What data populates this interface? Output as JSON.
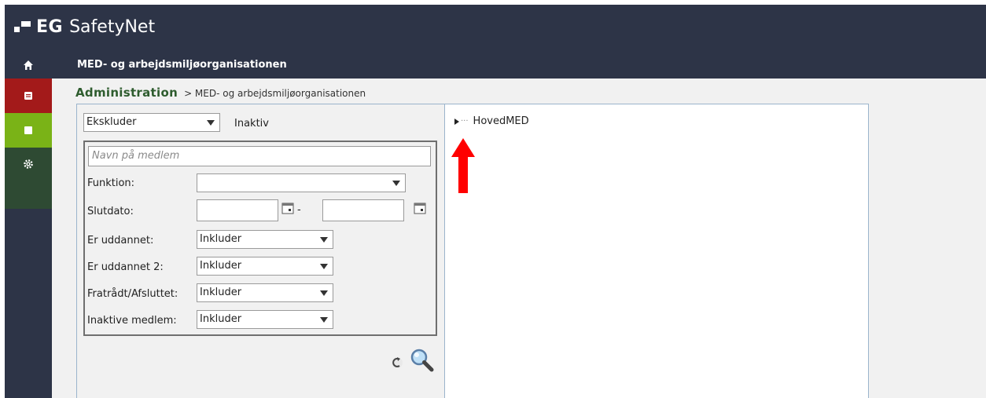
{
  "header": {
    "brand_mark": "EG",
    "app_name": "SafetyNet",
    "page_title": "MED- og arbejdsmiljøorganisationen"
  },
  "sidebar": {
    "items": [
      {
        "icon": "home-icon"
      },
      {
        "icon": "document-icon",
        "color": "#a31a1a"
      },
      {
        "icon": "square-icon",
        "color": "#7ab317"
      },
      {
        "icon": "gear-icon",
        "color": "#2e4a33"
      }
    ]
  },
  "breadcrumb": {
    "root": "Administration",
    "current": "> MED- og arbejdsmiljøorganisationen"
  },
  "filter": {
    "status_select": "Ekskluder",
    "status_label": "Inaktiv",
    "name_placeholder": "Navn på medlem",
    "funktion_label": "Funktion:",
    "funktion_value": "",
    "slutdato_label": "Slutdato:",
    "date_separator": "-",
    "rows": [
      {
        "label": "Er uddannet:",
        "value": "Inkluder"
      },
      {
        "label": "Er uddannet 2:",
        "value": "Inkluder"
      },
      {
        "label": "Fratrådt/Afsluttet:",
        "value": "Inkluder"
      },
      {
        "label": "Inaktive medlem:",
        "value": "Inkluder"
      }
    ]
  },
  "tree": {
    "root_label": "HovedMED",
    "connector": "···"
  },
  "colors": {
    "header_bg": "#2d3447",
    "breadcrumb_green": "#2e5c2e",
    "annotation_red": "#ff0000"
  }
}
